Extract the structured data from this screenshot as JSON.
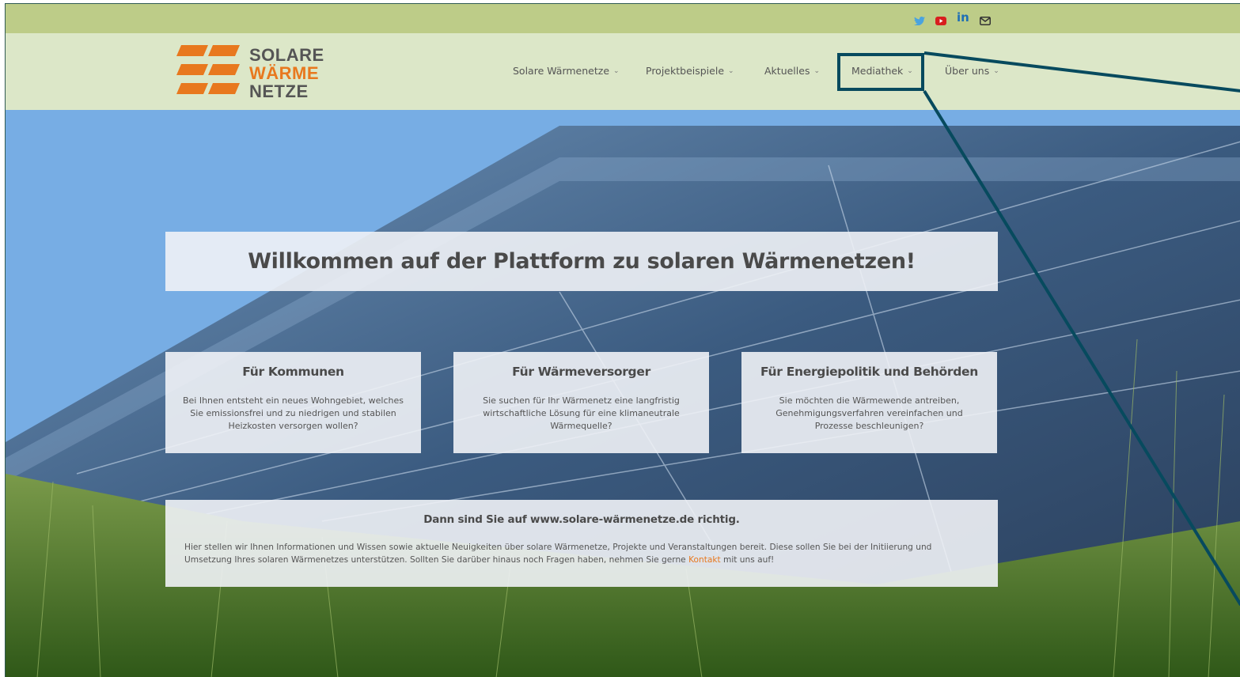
{
  "colors": {
    "topbar": "#bdcc88",
    "header": "#dce7c8",
    "brand_orange": "#e8781e",
    "highlight": "#074a5e",
    "twitter": "#4aa3df",
    "youtube": "#d81e1e",
    "linkedin": "#1f6fb5"
  },
  "social": {
    "icons": [
      "twitter-icon",
      "youtube-icon",
      "linkedin-icon",
      "mail-icon"
    ],
    "linkedin_label": "in"
  },
  "logo": {
    "line1": "SOLARE",
    "line2": "WÄRME",
    "line3": "NETZE"
  },
  "nav": {
    "items": [
      {
        "label": "Solare Wärmenetze"
      },
      {
        "label": "Projektbeispiele"
      },
      {
        "label": "Aktuelles"
      },
      {
        "label": "Mediathek"
      },
      {
        "label": "Über uns"
      }
    ],
    "chevron": "⌄",
    "highlighted": "Mediathek"
  },
  "hero": {
    "welcome": "Willkommen auf der Plattform zu solaren Wärmenetzen!",
    "cards": [
      {
        "title": "Für Kommunen",
        "text": "Bei Ihnen entsteht ein neues Wohngebiet, welches Sie emissionsfrei und zu niedrigen und stabilen Heizkosten versorgen wollen?"
      },
      {
        "title": "Für Wärmeversorger",
        "text": "Sie suchen für Ihr Wärmenetz eine langfristig wirtschaftliche Lösung für eine klimaneutrale Wärmequelle?"
      },
      {
        "title": "Für Energiepolitik und Behörden",
        "text": "Sie möchten die Wärmewende antreiben, Genehmigungsverfahren vereinfachen und Prozesse beschleunigen?"
      }
    ],
    "info": {
      "title": "Dann sind Sie auf www.solare-wärmenetze.de richtig.",
      "text_before": "Hier stellen wir Ihnen Informationen und Wissen sowie aktuelle Neuigkeiten über solare Wärmenetze, Projekte und Veranstaltungen bereit. Diese sollen Sie bei der Initiierung und Umsetzung Ihres solaren Wärmenetzes unterstützen. Sollten Sie darüber hinaus noch Fragen haben, nehmen Sie gerne ",
      "link": "Kontakt",
      "text_after": " mit uns auf!"
    }
  }
}
